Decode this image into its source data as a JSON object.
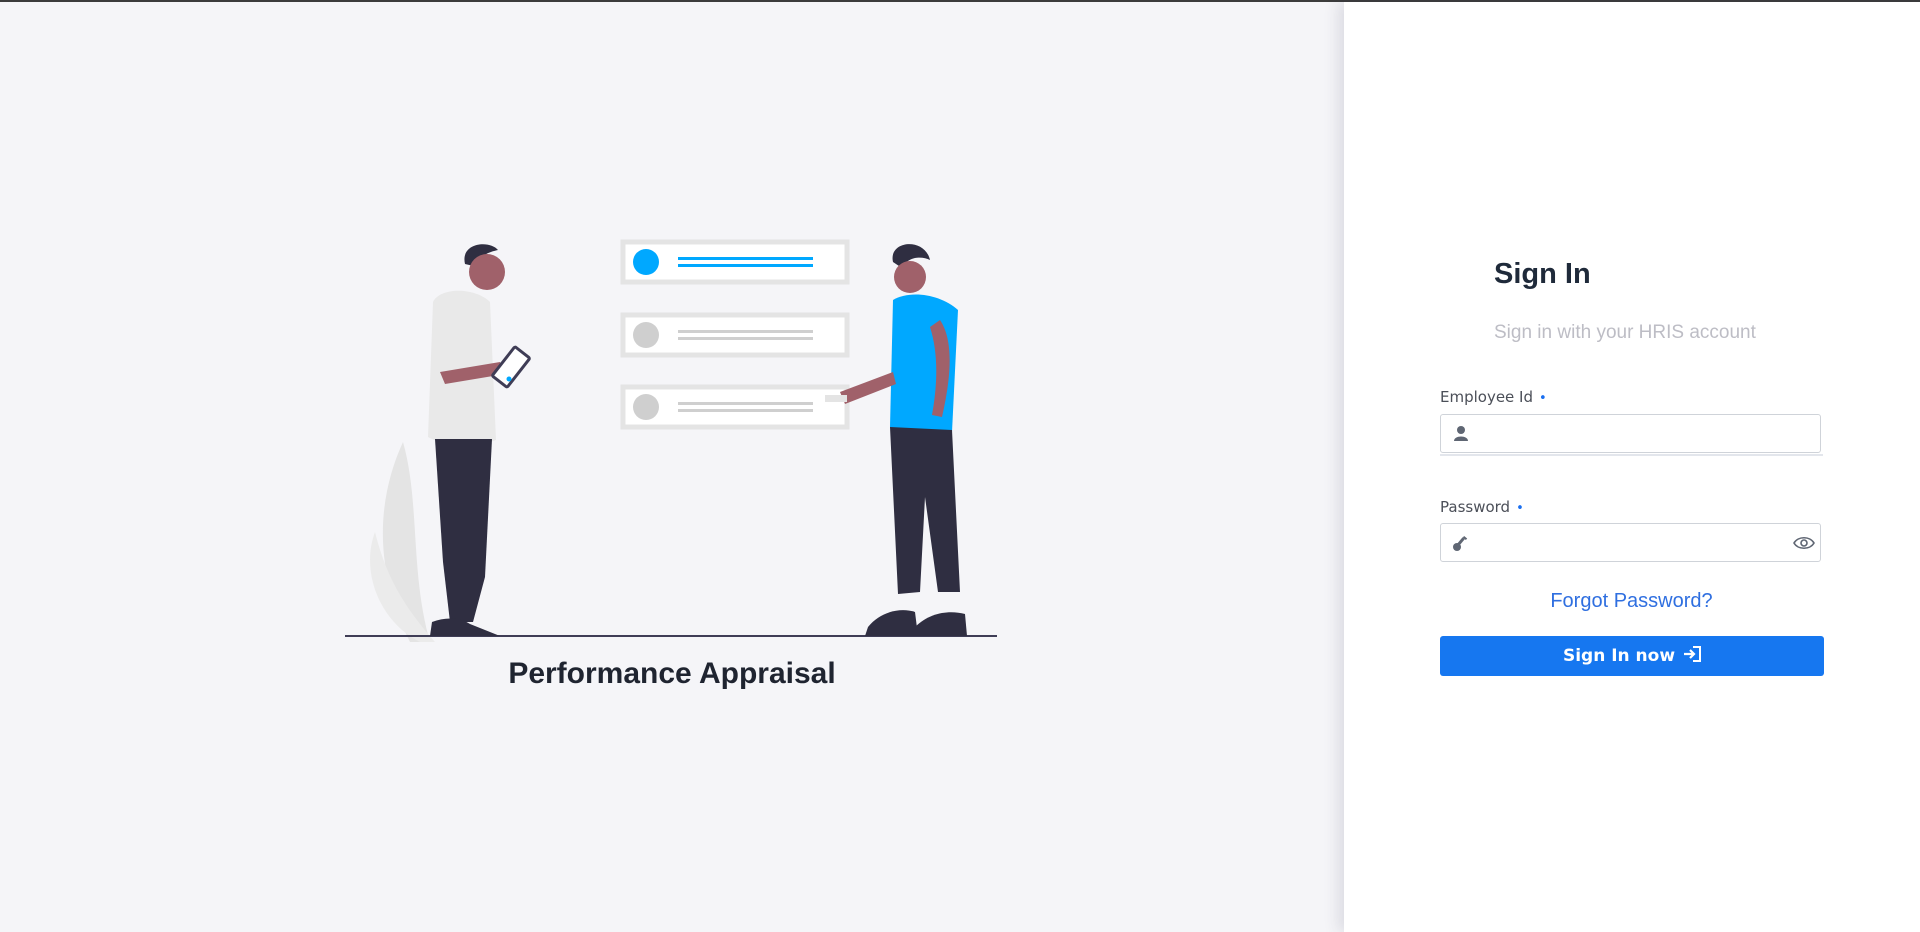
{
  "left": {
    "title": "Performance Appraisal"
  },
  "form": {
    "title": "Sign In",
    "subtitle": "Sign in with your HRIS account",
    "employee_id": {
      "label": "Employee Id",
      "required_mark": "•",
      "value": "",
      "icon": "user-icon"
    },
    "password": {
      "label": "Password",
      "required_mark": "•",
      "value": "",
      "icon": "key-icon",
      "toggle_icon": "eye-icon"
    },
    "forgot_label": "Forgot Password?",
    "submit_label": "Sign In now",
    "submit_icon": "sign-in-icon"
  },
  "colors": {
    "accent": "#1677f0",
    "illustration_blue": "#00a8ff",
    "background": "#f5f5f8"
  }
}
